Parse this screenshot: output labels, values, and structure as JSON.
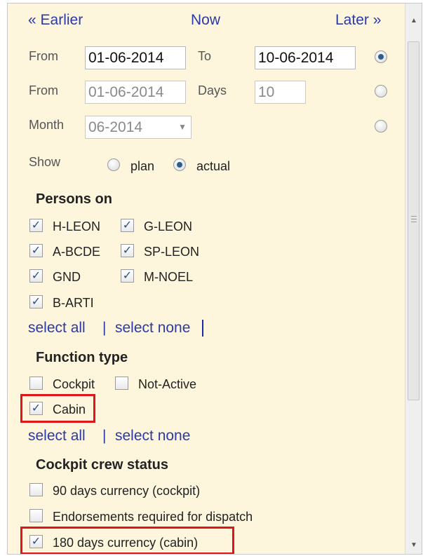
{
  "nav": {
    "earlier": "« Earlier",
    "now": "Now",
    "later": "Later »"
  },
  "range": {
    "from_label": "From",
    "from_value": "01-06-2014",
    "to_label": "To",
    "to_value": "10-06-2014",
    "selected": true
  },
  "days": {
    "from_label": "From",
    "from_value": "01-06-2014",
    "days_label": "Days",
    "days_value": "10",
    "selected": false
  },
  "month": {
    "label": "Month",
    "value": "06-2014",
    "selected": false
  },
  "show": {
    "label": "Show",
    "plan": "plan",
    "actual": "actual",
    "selected": "actual"
  },
  "persons": {
    "title": "Persons on",
    "items": [
      {
        "label": "H-LEON",
        "checked": true
      },
      {
        "label": "G-LEON",
        "checked": true
      },
      {
        "label": "A-BCDE",
        "checked": true
      },
      {
        "label": "SP-LEON",
        "checked": true
      },
      {
        "label": "GND",
        "checked": true
      },
      {
        "label": "M-NOEL",
        "checked": true
      },
      {
        "label": "B-ARTI",
        "checked": true
      }
    ],
    "select_all": "select all",
    "separator": "|",
    "select_none": "select none"
  },
  "function_type": {
    "title": "Function type",
    "items": [
      {
        "label": "Cockpit",
        "checked": false
      },
      {
        "label": "Not-Active",
        "checked": false
      },
      {
        "label": "Cabin",
        "checked": true
      }
    ],
    "select_all": "select all",
    "separator": "|",
    "select_none": "select none"
  },
  "cockpit_status": {
    "title": "Cockpit crew status",
    "items": [
      {
        "label": "90 days currency (cockpit)",
        "checked": false
      },
      {
        "label": "Endorsements required for dispatch",
        "checked": false
      },
      {
        "label": "180 days currency (cabin)",
        "checked": true
      }
    ]
  },
  "icons": {
    "check": "✓",
    "scroll_up": "▲",
    "scroll_down": "▼",
    "dropdown": "▼"
  },
  "colors": {
    "panel_bg": "#fdf5dc",
    "link": "#2b3aa6",
    "highlight": "#e0141b"
  }
}
